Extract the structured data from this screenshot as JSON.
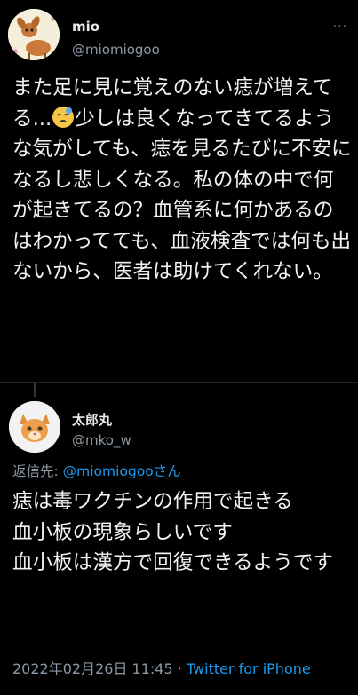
{
  "tweet": {
    "name": "mio",
    "handle": "@miomiogoo",
    "more": "···",
    "text_part1": "また足に見に覚えのない痣が増えてる...",
    "emoji": "worried-face-with-sweat",
    "text_part2": "少しは良くなってきてるような気がしても、痣を見るたびに不安になるし悲しくなる。私の体の中で何が起きてるの？血管系に何かあるのはわかってても、血液検査では何も出ないから、医者は助けてくれない。"
  },
  "reply": {
    "name": "太郎丸",
    "handle": "@mko_w",
    "reply_prefix": "返信先: ",
    "reply_link": "@miomiogoo",
    "reply_suffix": "さん",
    "text": "痣は毒ワクチンの作用で起きる\n血小板の現象らしいです\n血小板は漢方で回復できるようです",
    "date": "2022年02月26日 11:45 · ",
    "source": "Twitter for iPhone"
  },
  "colors": {
    "background": "#000000",
    "text": "#e7e9ea",
    "secondary": "#8b98a5",
    "accent": "#1d9bf0"
  }
}
